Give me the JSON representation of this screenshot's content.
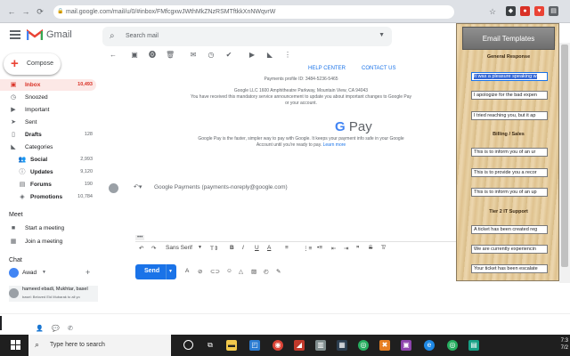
{
  "browser": {
    "url": "mail.google.com/mail/u/0/#inbox/FMfcgxwJWthMkZNzRSMTftkkXnNWqvrW"
  },
  "header": {
    "app_name": "Gmail",
    "search_placeholder": "Search mail"
  },
  "sidebar": {
    "compose_label": "Compose",
    "items": [
      {
        "label": "Inbox",
        "count": "10,493"
      },
      {
        "label": "Snoozed",
        "count": ""
      },
      {
        "label": "Important",
        "count": ""
      },
      {
        "label": "Sent",
        "count": ""
      },
      {
        "label": "Drafts",
        "count": "128"
      },
      {
        "label": "Categories",
        "count": ""
      },
      {
        "label": "Social",
        "count": "2,993"
      },
      {
        "label": "Updates",
        "count": "9,120"
      },
      {
        "label": "Forums",
        "count": "190"
      },
      {
        "label": "Promotions",
        "count": "10,784"
      }
    ],
    "meet_title": "Meet",
    "meet_items": [
      "Start a meeting",
      "Join a meeting"
    ],
    "chat_title": "Chat",
    "chat_user": "Awad",
    "chat_contact": "hameed ebadi, Mukhtar, basel",
    "chat_snippet": "basel: Beloved Eid Mubarak to all yo"
  },
  "email": {
    "help_center": "HELP CENTER",
    "contact_us": "CONTACT US",
    "profile_id": "Payments profile ID: 3484-5236-5465",
    "address": "Google LLC 1600 Amphitheatre Parkway, Mountain View, CA 94043",
    "notice": "You have received this mandatory service announcement to update you about important changes to Google Pay",
    "notice2": "or your account.",
    "gpay_letter": "G",
    "gpay_word": "Pay",
    "gpay_text": "Google Pay is the faster, simpler way to pay with Google. It keeps your payment info safe in your Google",
    "gpay_text2": "Account until you're ready to pay.",
    "learn_more": "Learn more"
  },
  "reply": {
    "recipient": "Google Payments (payments-noreply@google.com)",
    "font_name": "Sans Serif",
    "send_label": "Send"
  },
  "templates": {
    "title": "Email Templates",
    "categories": [
      {
        "name": "General Response",
        "items": [
          "It was a pleasure speaking w",
          "I apologize for the bad expen",
          "I tried reaching you, but it ap"
        ]
      },
      {
        "name": "Billing / Sales",
        "items": [
          "This is to inform you of an ur",
          "This is to provide you a recor",
          "This is to inform you of an up"
        ]
      },
      {
        "name": "Tier 2 IT Support",
        "items": [
          "A ticket has been created reg",
          "We are currently experiencin",
          "Your ticket has been escalate"
        ]
      }
    ]
  },
  "taskbar": {
    "search_placeholder": "Type here to search",
    "time": "7:3",
    "date": "7/2"
  },
  "colors": {
    "inbox_red": "#d93025",
    "send_blue": "#1a73e8",
    "template_wood": "#e7cfa3"
  }
}
